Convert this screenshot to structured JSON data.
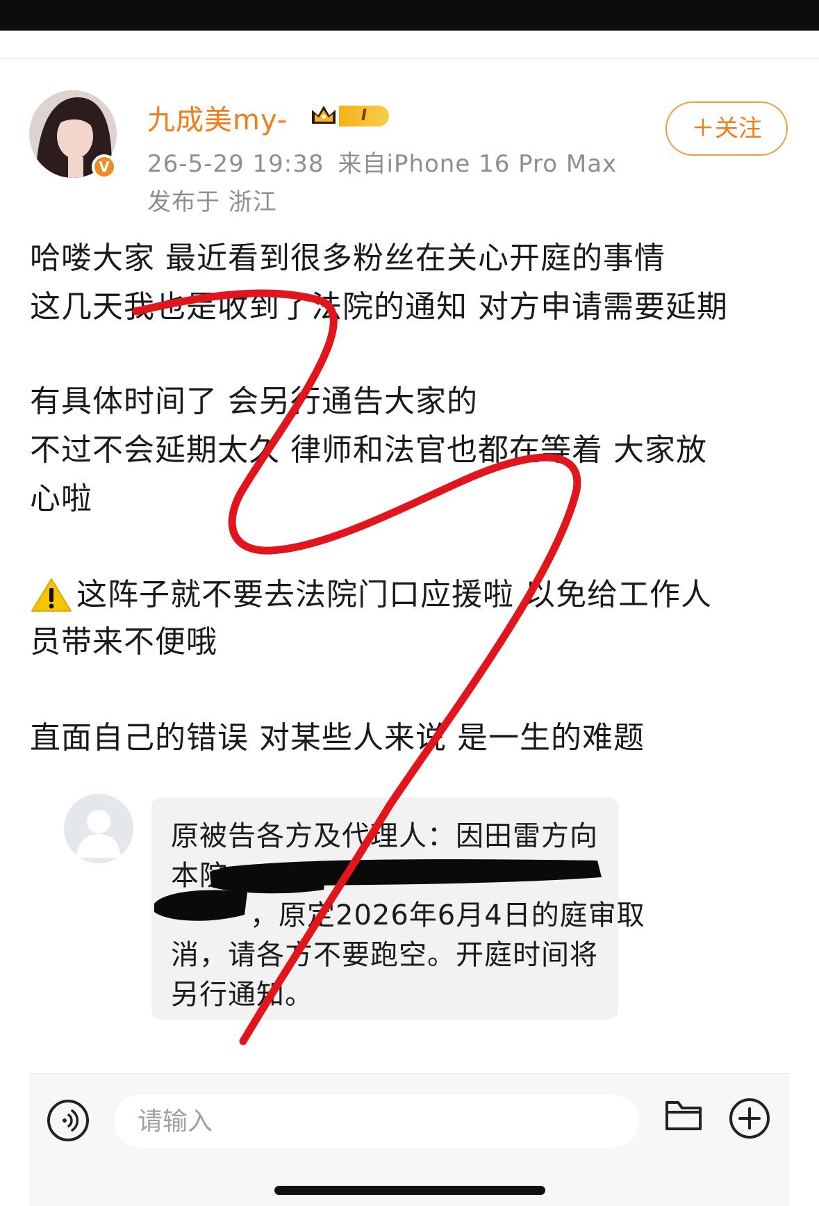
{
  "post": {
    "author": {
      "name": "九成美my-",
      "level_badge": "I",
      "verified_mark": "V"
    },
    "meta": {
      "timestamp": "26-5-29 19:38",
      "source": "来自iPhone 16 Pro Max",
      "location": "发布于 浙江"
    },
    "follow_label": "＋关注",
    "body_lines": [
      "哈喽大家 最近看到很多粉丝在关心开庭的事情",
      "这几天我也是收到了法院的通知 对方申请需要延期",
      "有具体时间了 会另行通告大家的",
      "不过不会延期太久 律师和法官也都在等着 大家放",
      "心啦",
      "这阵子就不要去法院门口应援啦 以免给工作人",
      "员带来不便哦",
      "直面自己的错误 对某些人来说 是一生的难题"
    ],
    "warning_icon": "warning-icon"
  },
  "screenshot": {
    "message_lines": [
      "原被告各方及代理人：因田雷方向",
      "本院",
      "，原定2026年6月4日的庭审取",
      "消，请各方不要跑空。开庭时间将",
      "另行通知。"
    ]
  },
  "composer": {
    "placeholder": "请输入",
    "voice_icon": "voice-icon",
    "folder_icon": "folder-icon",
    "add_icon": "plus-circle-icon"
  },
  "colors": {
    "accent": "#f27b1a",
    "scribble": "#e3151c",
    "redaction": "#0a0a0a"
  }
}
